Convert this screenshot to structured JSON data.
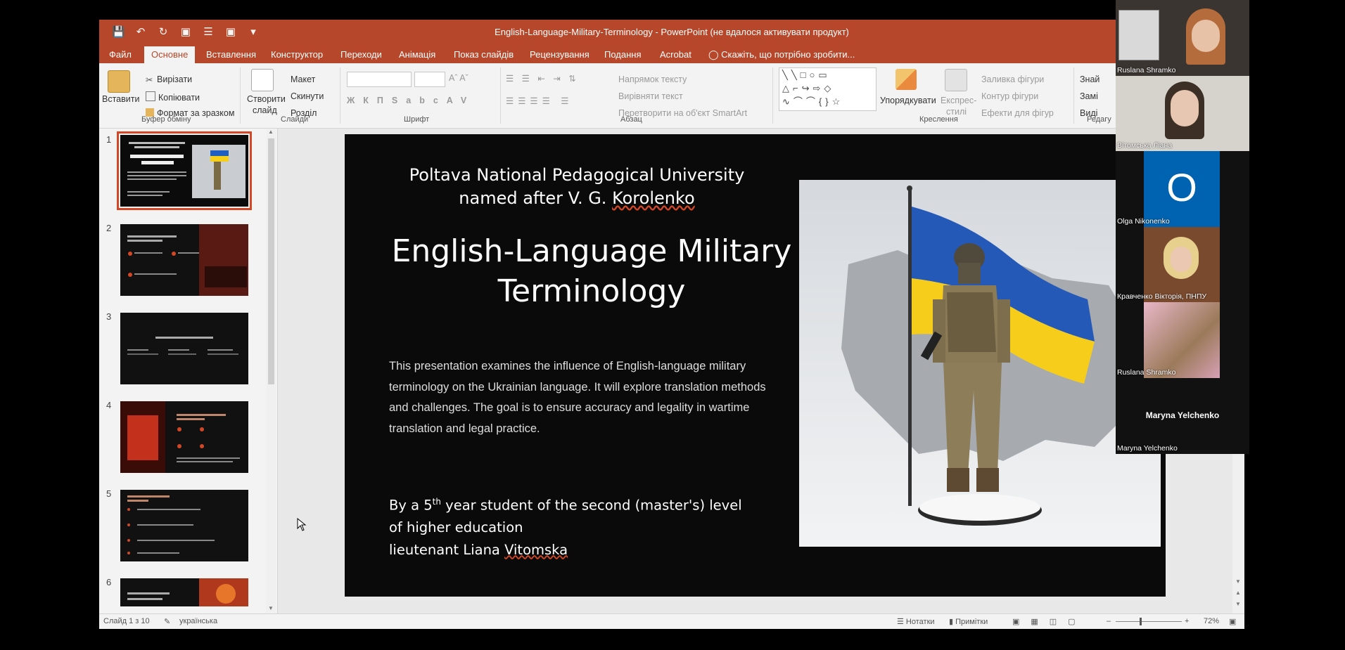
{
  "window": {
    "title": "English-Language-Military-Terminology - PowerPoint (не вдалося активувати продукт)"
  },
  "ribbon_tabs": [
    {
      "label": "Файл",
      "active": false
    },
    {
      "label": "Основне",
      "active": true
    },
    {
      "label": "Вставлення",
      "active": false
    },
    {
      "label": "Конструктор",
      "active": false
    },
    {
      "label": "Переходи",
      "active": false
    },
    {
      "label": "Анімація",
      "active": false
    },
    {
      "label": "Показ слайдів",
      "active": false
    },
    {
      "label": "Рецензування",
      "active": false
    },
    {
      "label": "Подання",
      "active": false
    },
    {
      "label": "Acrobat",
      "active": false
    }
  ],
  "tell_me": "Скажіть, що потрібно зробити...",
  "ribbon": {
    "clipboard": {
      "paste": "Вставити",
      "cut": "Вирізати",
      "copy": "Копіювати",
      "format_painter": "Формат за зразком",
      "group": "Буфер обміну"
    },
    "slides": {
      "new_slide_1": "Створити",
      "new_slide_2": "слайд",
      "layout": "Макет",
      "reset": "Скинути",
      "section": "Розділ",
      "group": "Слайди"
    },
    "font": {
      "group": "Шрифт"
    },
    "paragraph": {
      "text_direction": "Напрямок тексту",
      "align_text": "Вирівняти текст",
      "smartart": "Перетворити на об'єкт SmartArt",
      "group": "Абзац"
    },
    "drawing": {
      "arrange": "Упорядкувати",
      "quick_styles_1": "Експрес-",
      "quick_styles_2": "стилі",
      "shape_fill": "Заливка фігури",
      "shape_outline": "Контур фігури",
      "shape_effects": "Ефекти для фігур",
      "group": "Креслення"
    },
    "editing": {
      "find": "Знай",
      "replace": "Замі",
      "select": "Виді",
      "group": "Редагу"
    }
  },
  "thumbnails": [
    {
      "num": "1",
      "title": "Poltava National Pedagogical University named after V. G. Korolenko — English-Language Military Terminology",
      "selected": true
    },
    {
      "num": "2",
      "title": "Relevance of Studying Terminology",
      "selected": false
    },
    {
      "num": "3",
      "title": "Core Features of Military Terms",
      "selected": false
    },
    {
      "num": "4",
      "title": "Common Translation Methods",
      "selected": false
    },
    {
      "num": "5",
      "title": "Common Translation Methods",
      "selected": false
    },
    {
      "num": "6",
      "title": "International Humanitarian Law",
      "selected": false
    }
  ],
  "slide": {
    "university_line1": "Poltava National Pedagogical University",
    "university_line2_prefix": "named after V. G. ",
    "university_line2_name": "Korolenko",
    "title_line1": "English-Language Military",
    "title_line2": "Terminology",
    "body_line1": "This presentation examines the influence of English-language military",
    "body_line2": "terminology on the Ukrainian language. It will explore translation methods",
    "body_line3": "and challenges. The goal is to ensure accuracy and legality in wartime",
    "body_line4": "translation and legal practice.",
    "author_prefix": "By a 5",
    "author_sup": "th",
    "author_rest": " year student of the second (master's) level",
    "author_line2": "of higher education",
    "author_line3_prefix": "lieutenant Liana ",
    "author_line3_name": "Vitomska"
  },
  "status": {
    "slide_counter": "Слайд 1 з 10",
    "language": "українська",
    "notes": "Нотатки",
    "comments": "Примітки",
    "zoom": "72%"
  },
  "participants": [
    {
      "name": "Ruslana Shramko",
      "kind": "video"
    },
    {
      "name": "Вітомська Ліана",
      "kind": "video"
    },
    {
      "name": "Olga Nikonenko",
      "kind": "avatar",
      "initial": "O"
    },
    {
      "name": "Кравченко Вікторія, ПНПУ",
      "kind": "video"
    },
    {
      "name": "Ruslana Shramko",
      "kind": "image"
    },
    {
      "name": "Maryna Yelchenko",
      "kind": "name-only"
    }
  ],
  "colors": {
    "accent": "#b7472a",
    "selection": "#d24726",
    "avatar_blue": "#0063b1"
  }
}
